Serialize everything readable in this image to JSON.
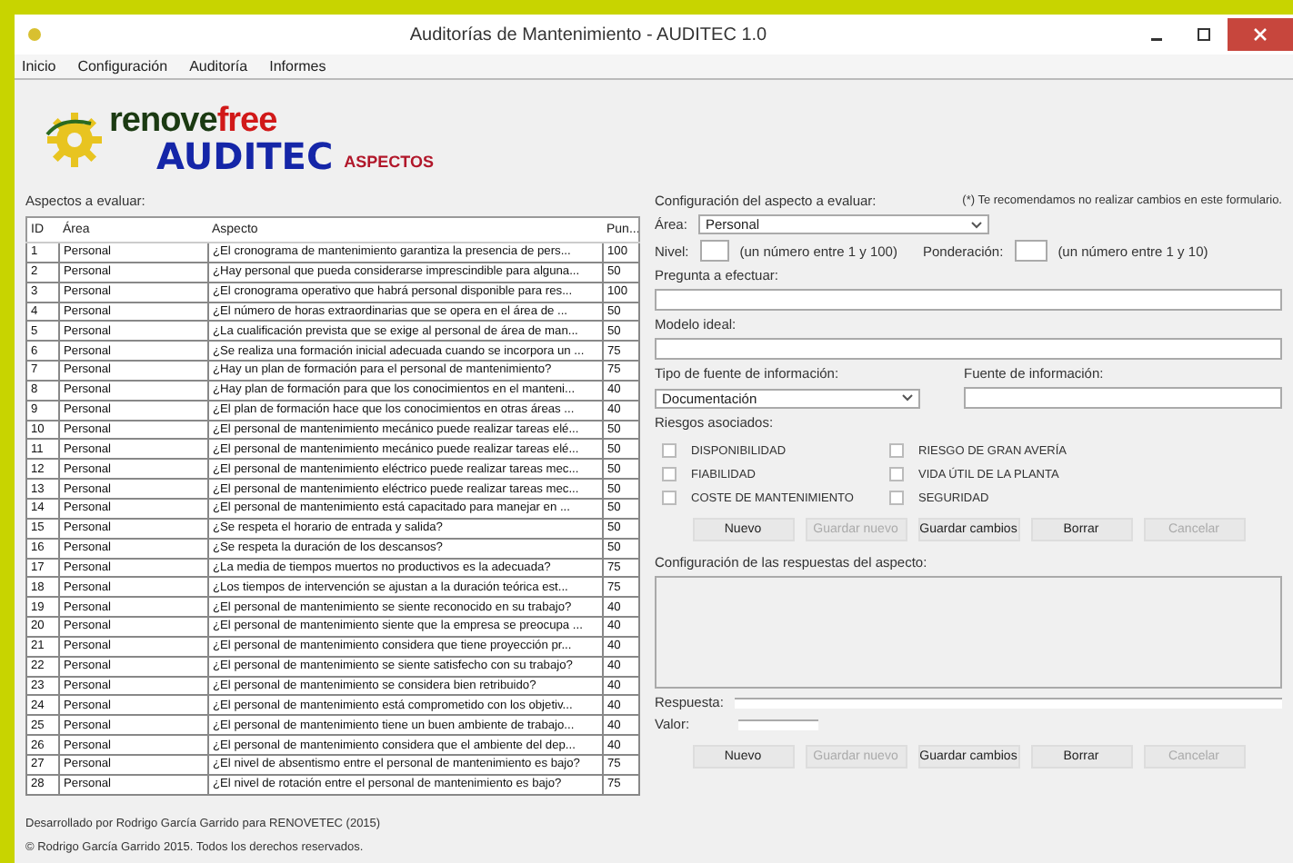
{
  "window": {
    "title": "Auditorías de Mantenimiento - AUDITEC 1.0"
  },
  "menu": [
    "Inicio",
    "Configuración",
    "Auditoría",
    "Informes"
  ],
  "logo": {
    "part1": "renove",
    "part2": "free",
    "part3": "AUDITEC"
  },
  "section_title": "ASPECTOS",
  "aspects": {
    "label": "Aspectos a evaluar:",
    "columns": [
      "ID",
      "Área",
      "Aspecto",
      "Pun..."
    ],
    "rows": [
      {
        "id": "1",
        "area": "Personal",
        "aspect": "¿El cronograma de mantenimiento garantiza la presencia de pers...",
        "points": "100"
      },
      {
        "id": "2",
        "area": "Personal",
        "aspect": "¿Hay personal que pueda considerarse imprescindible para alguna...",
        "points": "50"
      },
      {
        "id": "3",
        "area": "Personal",
        "aspect": "¿El cronograma operativo que habrá personal disponible para res...",
        "points": "100"
      },
      {
        "id": "4",
        "area": "Personal",
        "aspect": "¿El número de horas extraordinarias que se opera en el área de ...",
        "points": "50"
      },
      {
        "id": "5",
        "area": "Personal",
        "aspect": "¿La cualificación prevista que se exige al personal de área de man...",
        "points": "50"
      },
      {
        "id": "6",
        "area": "Personal",
        "aspect": "¿Se realiza una formación inicial adecuada cuando se incorpora un ...",
        "points": "75"
      },
      {
        "id": "7",
        "area": "Personal",
        "aspect": "¿Hay un plan de formación para el personal de mantenimiento?",
        "points": "75"
      },
      {
        "id": "8",
        "area": "Personal",
        "aspect": "¿Hay plan de formación para que los conocimientos en el manteni...",
        "points": "40"
      },
      {
        "id": "9",
        "area": "Personal",
        "aspect": "¿El plan de formación hace que los conocimientos en otras áreas ...",
        "points": "40"
      },
      {
        "id": "10",
        "area": "Personal",
        "aspect": "¿El personal de mantenimiento mecánico puede realizar tareas elé...",
        "points": "50"
      },
      {
        "id": "11",
        "area": "Personal",
        "aspect": "¿El personal de mantenimiento mecánico puede realizar tareas elé...",
        "points": "50"
      },
      {
        "id": "12",
        "area": "Personal",
        "aspect": "¿El personal de mantenimiento eléctrico puede realizar tareas mec...",
        "points": "50"
      },
      {
        "id": "13",
        "area": "Personal",
        "aspect": "¿El personal de mantenimiento eléctrico puede realizar tareas mec...",
        "points": "50"
      },
      {
        "id": "14",
        "area": "Personal",
        "aspect": "¿El personal de mantenimiento está capacitado para manejar en ...",
        "points": "50"
      },
      {
        "id": "15",
        "area": "Personal",
        "aspect": "¿Se respeta el horario de entrada y salida?",
        "points": "50"
      },
      {
        "id": "16",
        "area": "Personal",
        "aspect": "¿Se respeta la duración de los descansos?",
        "points": "50"
      },
      {
        "id": "17",
        "area": "Personal",
        "aspect": "¿La media de tiempos muertos no productivos es la adecuada?",
        "points": "75"
      },
      {
        "id": "18",
        "area": "Personal",
        "aspect": "¿Los tiempos de intervención se ajustan a la duración teórica est...",
        "points": "75"
      },
      {
        "id": "19",
        "area": "Personal",
        "aspect": "¿El personal de mantenimiento se siente reconocido en su trabajo?",
        "points": "40"
      },
      {
        "id": "20",
        "area": "Personal",
        "aspect": "¿El personal de mantenimiento siente que la empresa se preocupa ...",
        "points": "40"
      },
      {
        "id": "21",
        "area": "Personal",
        "aspect": "¿El personal de mantenimiento considera que tiene proyección pr...",
        "points": "40"
      },
      {
        "id": "22",
        "area": "Personal",
        "aspect": "¿El personal de mantenimiento se siente satisfecho con su trabajo?",
        "points": "40"
      },
      {
        "id": "23",
        "area": "Personal",
        "aspect": "¿El personal de mantenimiento se considera bien retribuido?",
        "points": "40"
      },
      {
        "id": "24",
        "area": "Personal",
        "aspect": "¿El personal de mantenimiento está comprometido con los objetiv...",
        "points": "40"
      },
      {
        "id": "25",
        "area": "Personal",
        "aspect": "¿El personal de mantenimiento tiene un buen ambiente de trabajo...",
        "points": "40"
      },
      {
        "id": "26",
        "area": "Personal",
        "aspect": "¿El personal de mantenimiento considera que el ambiente del dep...",
        "points": "40"
      },
      {
        "id": "27",
        "area": "Personal",
        "aspect": "¿El nivel de absentismo entre el personal de mantenimiento es bajo?",
        "points": "75"
      },
      {
        "id": "28",
        "area": "Personal",
        "aspect": "¿El nivel de rotación entre el personal de mantenimiento es bajo?",
        "points": "75"
      }
    ]
  },
  "footer": [
    "Desarrollado por Rodrigo García Garrido para RENOVETEC (2015)",
    "© Rodrigo García Garrido 2015. Todos los derechos reservados."
  ],
  "config": {
    "label": "Configuración del aspecto a evaluar:",
    "note": "(*) Te recomendamos no realizar cambios en este formulario.",
    "area_label": "Área:",
    "area_value": "Personal",
    "nivel_label": "Nivel:",
    "nivel_hint": "(un número entre 1 y 100)",
    "ponderacion_label": "Ponderación:",
    "ponderacion_hint": "(un número entre 1 y 10)",
    "pregunta_label": "Pregunta a efectuar:",
    "modelo_label": "Modelo ideal:",
    "tipo_label": "Tipo de fuente de información:",
    "tipo_value": "Documentación",
    "fuente_label": "Fuente de información:",
    "riesgos_label": "Riesgos asociados:",
    "riesgos": [
      {
        "label": "DISPONIBILIDAD",
        "checked": false
      },
      {
        "label": "RIESGO DE GRAN AVERÍA",
        "checked": false
      },
      {
        "label": "FIABILIDAD",
        "checked": false
      },
      {
        "label": "VIDA ÚTIL DE LA PLANTA",
        "checked": false
      },
      {
        "label": "COSTE DE MANTENIMIENTO",
        "checked": false
      },
      {
        "label": "SEGURIDAD",
        "checked": false
      }
    ],
    "buttons": [
      {
        "label": "Nuevo",
        "disabled": false
      },
      {
        "label": "Guardar nuevo",
        "disabled": true
      },
      {
        "label": "Guardar cambios",
        "disabled": false
      },
      {
        "label": "Borrar",
        "disabled": false
      },
      {
        "label": "Cancelar",
        "disabled": true
      }
    ]
  },
  "responses": {
    "label": "Configuración de las respuestas del aspecto:",
    "respuesta_label": "Respuesta:",
    "valor_label": "Valor:",
    "buttons": [
      {
        "label": "Nuevo",
        "disabled": false
      },
      {
        "label": "Guardar nuevo",
        "disabled": true
      },
      {
        "label": "Guardar cambios",
        "disabled": false
      },
      {
        "label": "Borrar",
        "disabled": false
      },
      {
        "label": "Cancelar",
        "disabled": true
      }
    ]
  }
}
